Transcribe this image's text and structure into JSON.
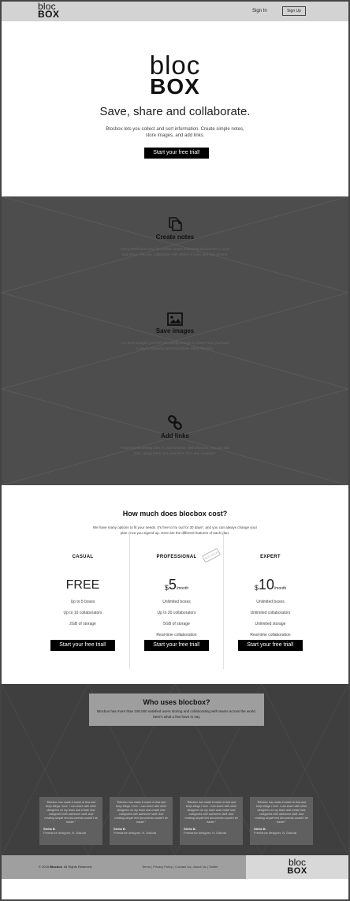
{
  "header": {
    "logo_top": "bloc",
    "logo_bottom": "BOX",
    "signin_label": "Sign In",
    "signup_label": "Sign Up"
  },
  "hero": {
    "logo_top": "bloc",
    "logo_bottom": "BOX",
    "title": "Save, share and collaborate.",
    "description": "Blocbox lets you collect and sort information. Create simple notes, store images, and add links.",
    "cta_label": "Start your free trial!"
  },
  "features": [
    {
      "icon": "files-icon",
      "title": "Create notes",
      "description": "Using Weblovers you can create simple textbased documents to save and share. You can collaborate with others to write and edit content."
    },
    {
      "icon": "image-icon",
      "title": "Save images",
      "description": "Are there images you find interesting enough to save? Now you have a way to organize and store those within blocbox."
    },
    {
      "icon": "link-icon",
      "title": "Add links",
      "description": "Forget bookmarking sites in your browser. With Blocbox, you can add links, group them and view them from any computer."
    }
  ],
  "pricing": {
    "title": "How much does blocbox cost?",
    "description": "We have many options to fit your needs. It's free to try out for 30 days*, and you can always change your plan once you signed up. Here are the different features of each plan.",
    "stamp_label": "BEST VALUE",
    "plans": [
      {
        "name": "CASUAL",
        "price": "FREE",
        "features": [
          "Up to 5 boxes",
          "Up to 10 collaborators",
          "2GB of storage"
        ],
        "cta_label": "Start your free trial!"
      },
      {
        "name": "PROFESSIONAL",
        "currency": "$",
        "amount": "5",
        "period": "/month",
        "features": [
          "Unlimited boxes",
          "Up to 20 collaborators",
          "5GB of storage",
          "Real-time collaboration"
        ],
        "cta_label": "Start your free trial!"
      },
      {
        "name": "EXPERT",
        "currency": "$",
        "amount": "10",
        "period": "/month",
        "features": [
          "Unlimited boxes",
          "Unlimited collaborators",
          "Unlimited storage",
          "Real-time collaboration"
        ],
        "cta_label": "Start your free trial!"
      }
    ]
  },
  "users": {
    "title": "Who uses blocbox?",
    "description": "Blocbox has more than 100,000 satisfied users storing and collaborating with teams across the world. Here's what a few have to say.",
    "testimonials": [
      {
        "quote": "\"Blocbox has made it easier to find and keep things I love. I can share with other designers on my team and create new categories with awesome stuff. And creating simple text documents couldn't be easier.\"",
        "name": "Stella B.",
        "role": "Freelance designer, N. Dakota"
      },
      {
        "quote": "\"Blocbox has made it easier to find and keep things I love. I can share with other designers on my team and create new categories with awesome stuff. And creating simple text documents couldn't be easier.\"",
        "name": "Stella B.",
        "role": "Freelance designer, N. Dakota"
      },
      {
        "quote": "\"Blocbox has made it easier to find and keep things I love. I can share with other designers on my team and create new categories with awesome stuff. And creating simple text documents couldn't be easier.\"",
        "name": "Stella B.",
        "role": "Freelance designer, N. Dakota"
      },
      {
        "quote": "\"Blocbox has made it easier to find and keep things I love. I can share with other designers on my team and create new categories with awesome stuff. And creating simple text documents couldn't be easier.\"",
        "name": "Stella B.",
        "role": "Freelance designer, N. Dakota"
      }
    ]
  },
  "footer": {
    "copyright_prefix": "© 2015 ",
    "copyright_brand": "Blocbox",
    "copyright_suffix": ". All Rights Reserved.",
    "links": "Terms | Privacy Policy | Contact Us | About Us | Twitter",
    "logo_top": "bloc",
    "logo_bottom": "BOX"
  },
  "colors": {
    "accent": "#000000",
    "header_bg": "#d3d3d3",
    "features_bg": "#4d4d4d",
    "users_bg": "#3f3f3f",
    "footer_bg": "#9f9f9f"
  }
}
